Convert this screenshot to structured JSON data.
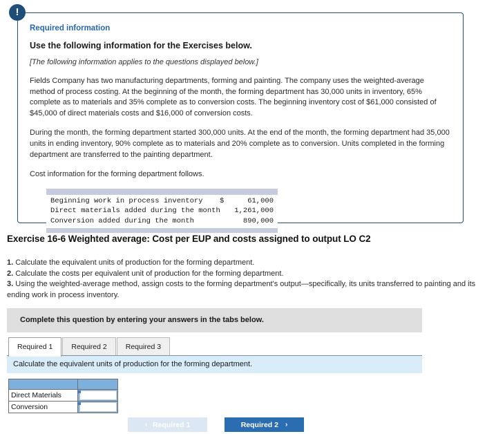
{
  "required_info_card": {
    "alert_icon": "exclamation-icon",
    "heading": "Required information",
    "title": "Use the following information for the Exercises below.",
    "italic_note": "[The following information applies to the questions displayed below.]",
    "paragraph_1": "Fields Company has two manufacturing departments, forming and painting. The company uses the weighted-average method of process costing. At the beginning of the month, the forming department has 30,000 units in inventory, 65% complete as to materials and 35% complete as to conversion costs. The beginning inventory cost of $61,000 consisted of $45,000 of direct materials costs and $16,000 of conversion costs.",
    "paragraph_2": "During the month, the forming department started 300,000 units. At the end of the month, the forming department had 35,000 units in ending inventory, 90% complete as to materials and 20% complete as to conversion. Units completed in the forming department are transferred to the painting department.",
    "paragraph_3": "Cost information for the forming department follows.",
    "cost_table": {
      "rows": [
        {
          "label": "Beginning work in process inventory",
          "currency": "$",
          "value": "61,000"
        },
        {
          "label": "Direct materials added during the month",
          "currency": "",
          "value": "1,261,000"
        },
        {
          "label": "Conversion added during the month",
          "currency": "",
          "value": "890,000"
        }
      ]
    }
  },
  "exercise": {
    "title": "Exercise 16-6 Weighted average: Cost per EUP and costs assigned to output LO C2",
    "instructions": [
      {
        "num": "1.",
        "text": " Calculate the equivalent units of production for the forming department."
      },
      {
        "num": "2.",
        "text": " Calculate the costs per equivalent unit of production for the forming department."
      },
      {
        "num": "3.",
        "text": " Using the weighted-average method, assign costs to the forming department's output—specifically, its units transferred to painting and its ending work in process inventory."
      }
    ]
  },
  "answer_area": {
    "complete_banner": "Complete this question by entering your answers in the tabs below.",
    "tabs": [
      {
        "label": "Required 1",
        "active": true
      },
      {
        "label": "Required 2",
        "active": false
      },
      {
        "label": "Required 3",
        "active": false
      }
    ],
    "sub_instruction": "Calculate the equivalent units of production for the forming department.",
    "table": {
      "header": [
        "",
        ""
      ],
      "rows": [
        {
          "label": "Direct Materials",
          "value": ""
        },
        {
          "label": "Conversion",
          "value": ""
        }
      ]
    }
  },
  "navigation": {
    "prev_label": "Required 1",
    "prev_chevron": "‹",
    "next_label": "Required 2",
    "next_chevron": "›"
  },
  "colors": {
    "card_border": "#1f4e79",
    "heading_blue": "#2a66b0",
    "banner_gray": "#dedede",
    "sub_instruction_blue": "#d9ecfa",
    "table_header_blue": "#7eb0de",
    "next_button_blue": "#2a6db0",
    "prev_button_blue": "#dbe7f2",
    "cost_bar_gray": "#c6cbdd"
  }
}
